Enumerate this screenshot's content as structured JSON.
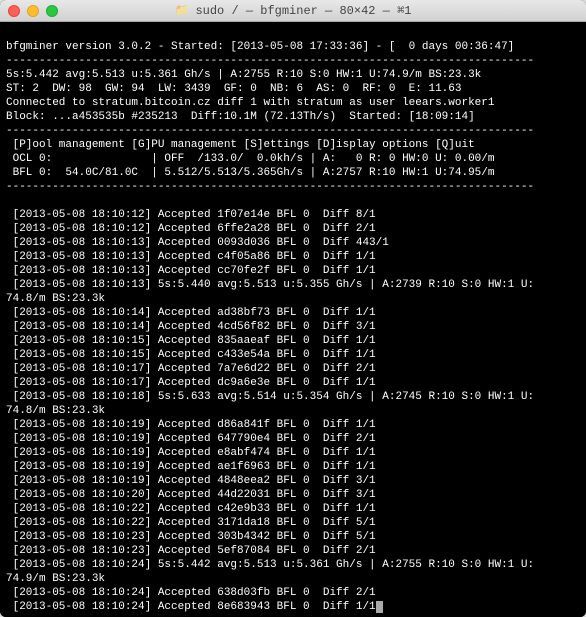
{
  "window": {
    "title": "sudo  / — bfgminer — 80×42 — ⌘1"
  },
  "header": {
    "line1": "bfgminer version 3.0.2 - Started: [2013-05-08 17:33:36] - [  0 days 00:36:47]",
    "divider1": "--------------------------------------------------------------------------------",
    "line2": "5s:5.442 avg:5.513 u:5.361 Gh/s | A:2755 R:10 S:0 HW:1 U:74.9/m BS:23.3k",
    "line3": "ST: 2  DW: 98  GW: 94  LW: 3439  GF: 0  NB: 6  AS: 0  RF: 0  E: 11.63",
    "line4": "Connected to stratum.bitcoin.cz diff 1 with stratum as user leears.worker1",
    "line5": "Block: ...a453535b #235213  Diff:10.1M (72.13Th/s)  Started: [18:09:14]",
    "divider2": "--------------------------------------------------------------------------------",
    "line6": " [P]ool management [G]PU management [S]ettings [D]isplay options [Q]uit",
    "line7": " OCL 0:               | OFF  /133.0/  0.0kh/s | A:   0 R: 0 HW:0 U: 0.00/m",
    "line8": " BFL 0:  54.0C/81.0C  | 5.512/5.513/5.365Gh/s | A:2757 R:10 HW:1 U:74.95/m",
    "divider3": "--------------------------------------------------------------------------------"
  },
  "log_lines": [
    " [2013-05-08 18:10:12] Accepted 1f07e14e BFL 0  Diff 8/1",
    " [2013-05-08 18:10:12] Accepted 6ffe2a28 BFL 0  Diff 2/1",
    " [2013-05-08 18:10:13] Accepted 0093d036 BFL 0  Diff 443/1",
    " [2013-05-08 18:10:13] Accepted c4f05a86 BFL 0  Diff 1/1",
    " [2013-05-08 18:10:13] Accepted cc70fe2f BFL 0  Diff 1/1",
    " [2013-05-08 18:10:13] 5s:5.440 avg:5.513 u:5.355 Gh/s | A:2739 R:10 S:0 HW:1 U:",
    "74.8/m BS:23.3k",
    " [2013-05-08 18:10:14] Accepted ad38bf73 BFL 0  Diff 1/1",
    " [2013-05-08 18:10:14] Accepted 4cd56f82 BFL 0  Diff 3/1",
    " [2013-05-08 18:10:15] Accepted 835aaeaf BFL 0  Diff 1/1",
    " [2013-05-08 18:10:15] Accepted c433e54a BFL 0  Diff 1/1",
    " [2013-05-08 18:10:17] Accepted 7a7e6d22 BFL 0  Diff 2/1",
    " [2013-05-08 18:10:17] Accepted dc9a6e3e BFL 0  Diff 1/1",
    " [2013-05-08 18:10:18] 5s:5.633 avg:5.514 u:5.354 Gh/s | A:2745 R:10 S:0 HW:1 U:",
    "74.8/m BS:23.3k",
    " [2013-05-08 18:10:19] Accepted d86a841f BFL 0  Diff 1/1",
    " [2013-05-08 18:10:19] Accepted 647790e4 BFL 0  Diff 2/1",
    " [2013-05-08 18:10:19] Accepted e8abf474 BFL 0  Diff 1/1",
    " [2013-05-08 18:10:19] Accepted ae1f6963 BFL 0  Diff 1/1",
    " [2013-05-08 18:10:19] Accepted 4848eea2 BFL 0  Diff 3/1",
    " [2013-05-08 18:10:20] Accepted 44d22031 BFL 0  Diff 3/1",
    " [2013-05-08 18:10:22] Accepted c42e9b33 BFL 0  Diff 1/1",
    " [2013-05-08 18:10:22] Accepted 3171da18 BFL 0  Diff 5/1",
    " [2013-05-08 18:10:23] Accepted 303b4342 BFL 0  Diff 5/1",
    " [2013-05-08 18:10:23] Accepted 5ef87084 BFL 0  Diff 2/1",
    " [2013-05-08 18:10:24] 5s:5.442 avg:5.513 u:5.361 Gh/s | A:2755 R:10 S:0 HW:1 U:",
    "74.9/m BS:23.3k",
    " [2013-05-08 18:10:24] Accepted 638d03fb BFL 0  Diff 2/1",
    " [2013-05-08 18:10:24] Accepted 8e683943 BFL 0  Diff 1/1"
  ]
}
